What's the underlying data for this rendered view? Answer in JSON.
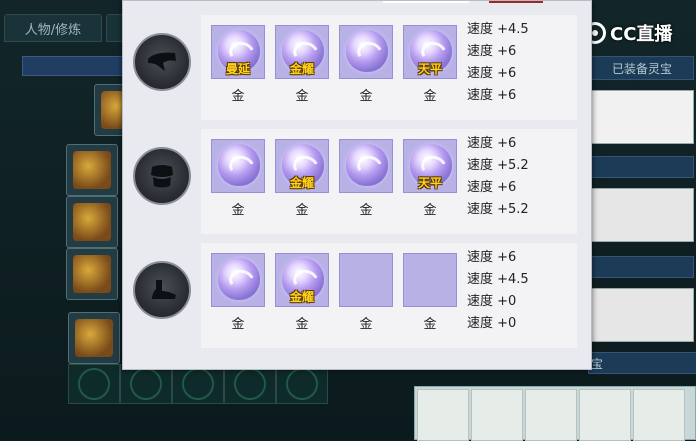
{
  "background": {
    "tabs": [
      "人物/修炼",
      ""
    ],
    "equipped_label": "已装备灵宝",
    "lower_label": "宝"
  },
  "watermark": {
    "text": "CC直播"
  },
  "modal": {
    "rows": [
      {
        "icon": "hat-icon",
        "slots": [
          {
            "filled": true,
            "label": "曼延",
            "caption": "金"
          },
          {
            "filled": true,
            "label": "金耀",
            "caption": "金"
          },
          {
            "filled": true,
            "label": "",
            "caption": "金"
          },
          {
            "filled": true,
            "label": "天平",
            "caption": "金"
          }
        ],
        "stats": [
          "速度 +4.5",
          "速度 +6",
          "速度 +6",
          "速度 +6"
        ]
      },
      {
        "icon": "armor-icon",
        "slots": [
          {
            "filled": true,
            "label": "",
            "caption": "金"
          },
          {
            "filled": true,
            "label": "金耀",
            "caption": "金"
          },
          {
            "filled": true,
            "label": "",
            "caption": "金"
          },
          {
            "filled": true,
            "label": "天平",
            "caption": "金"
          }
        ],
        "stats": [
          "速度 +6",
          "速度 +5.2",
          "速度 +6",
          "速度 +5.2"
        ]
      },
      {
        "icon": "boots-icon",
        "slots": [
          {
            "filled": true,
            "label": "",
            "caption": "金"
          },
          {
            "filled": true,
            "label": "金耀",
            "caption": "金"
          },
          {
            "filled": false,
            "label": "",
            "caption": "金"
          },
          {
            "filled": false,
            "label": "",
            "caption": "金"
          }
        ],
        "stats": [
          "速度 +6",
          "速度 +4.5",
          "速度 +0",
          "速度 +0"
        ]
      }
    ]
  }
}
